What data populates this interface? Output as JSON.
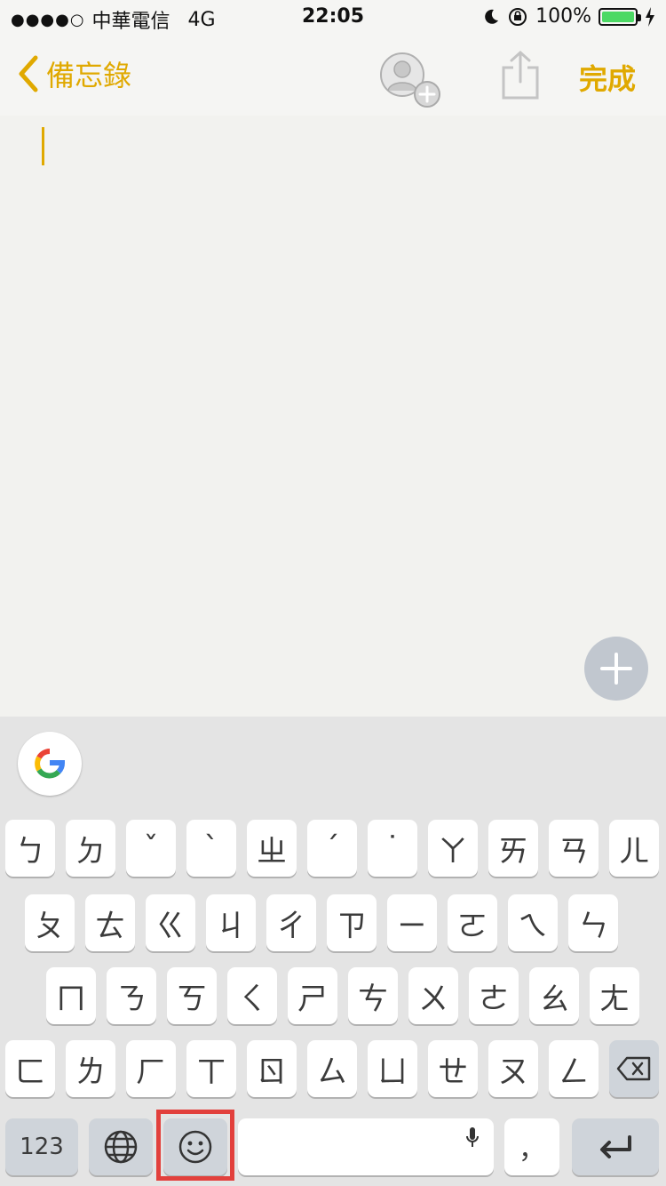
{
  "status": {
    "carrier": "中華電信",
    "network": "4G",
    "time": "22:05",
    "battery": "100%"
  },
  "nav": {
    "back_label": "備忘錄",
    "done_label": "完成"
  },
  "keyboard": {
    "rows": [
      [
        "ㄅ",
        "ㄉ",
        "ˇ",
        "ˋ",
        "ㄓ",
        "ˊ",
        "˙",
        "ㄚ",
        "ㄞ",
        "ㄢ",
        "ㄦ"
      ],
      [
        "ㄆ",
        "ㄊ",
        "ㄍ",
        "ㄐ",
        "ㄔ",
        "ㄗ",
        "ㄧ",
        "ㄛ",
        "ㄟ",
        "ㄣ"
      ],
      [
        "ㄇ",
        "ㄋ",
        "ㄎ",
        "ㄑ",
        "ㄕ",
        "ㄘ",
        "ㄨ",
        "ㄜ",
        "ㄠ",
        "ㄤ"
      ],
      [
        "ㄈ",
        "ㄌ",
        "ㄏ",
        "ㄒ",
        "ㄖ",
        "ㄙ",
        "ㄩ",
        "ㄝ",
        "ㄡ",
        "ㄥ"
      ]
    ],
    "numbers_label": "123",
    "comma_label": "，"
  },
  "colors": {
    "accent": "#e0a900",
    "highlight": "#e2403c"
  }
}
